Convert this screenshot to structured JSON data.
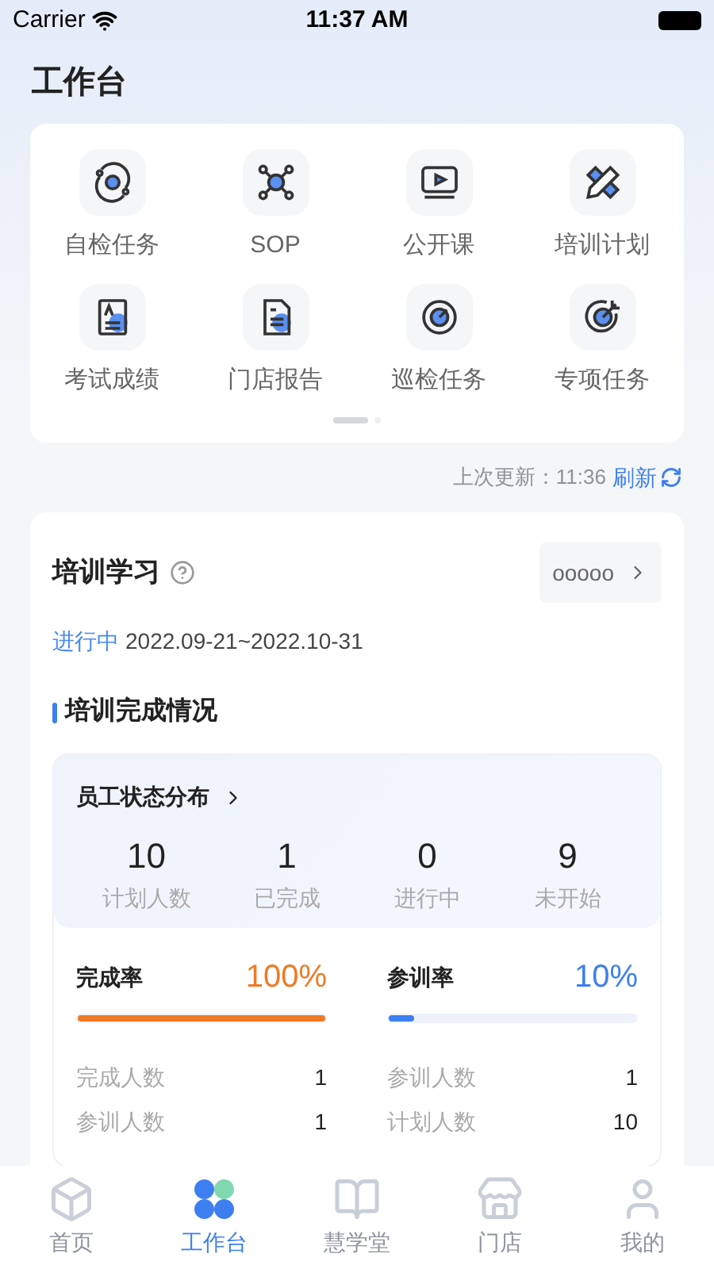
{
  "status_bar": {
    "carrier": "Carrier",
    "time": "11:37 AM"
  },
  "page_title": "工作台",
  "shortcuts": [
    {
      "label": "自检任务"
    },
    {
      "label": "SOP"
    },
    {
      "label": "公开课"
    },
    {
      "label": "培训计划"
    },
    {
      "label": "考试成绩"
    },
    {
      "label": "门店报告"
    },
    {
      "label": "巡检任务"
    },
    {
      "label": "专项任务"
    }
  ],
  "pager": [
    {
      "selected": true
    },
    {
      "selected": false
    }
  ],
  "update": {
    "label": "上次更新：11:36",
    "refresh": "刷新"
  },
  "training": {
    "title": "培训学习",
    "selector": "ooooo",
    "status": "进行中",
    "date_range": "2022.09-21~2022.10-31",
    "section_title": "培训完成情况",
    "distribution": {
      "title": "员工状态分布",
      "stats": [
        {
          "value": "10",
          "label": "计划人数"
        },
        {
          "value": "1",
          "label": "已完成"
        },
        {
          "value": "0",
          "label": "进行中"
        },
        {
          "value": "9",
          "label": "未开始"
        }
      ]
    },
    "rates": [
      {
        "label": "完成率",
        "value": "100%",
        "level": 1,
        "color": "#f07a26",
        "details": [
          {
            "label": "完成人数",
            "value": "1"
          },
          {
            "label": "参训人数",
            "value": "1"
          }
        ]
      },
      {
        "label": "参训率",
        "value": "10%",
        "level": 0.1,
        "color": "#3d7ff0",
        "details": [
          {
            "label": "参训人数",
            "value": "1"
          },
          {
            "label": "计划人数",
            "value": "10"
          }
        ]
      }
    ]
  },
  "tabs": [
    {
      "label": "首页",
      "selected": false
    },
    {
      "label": "工作台",
      "selected": true
    },
    {
      "label": "慧学堂",
      "selected": false
    },
    {
      "label": "门店",
      "selected": false
    },
    {
      "label": "我的",
      "selected": false
    }
  ]
}
